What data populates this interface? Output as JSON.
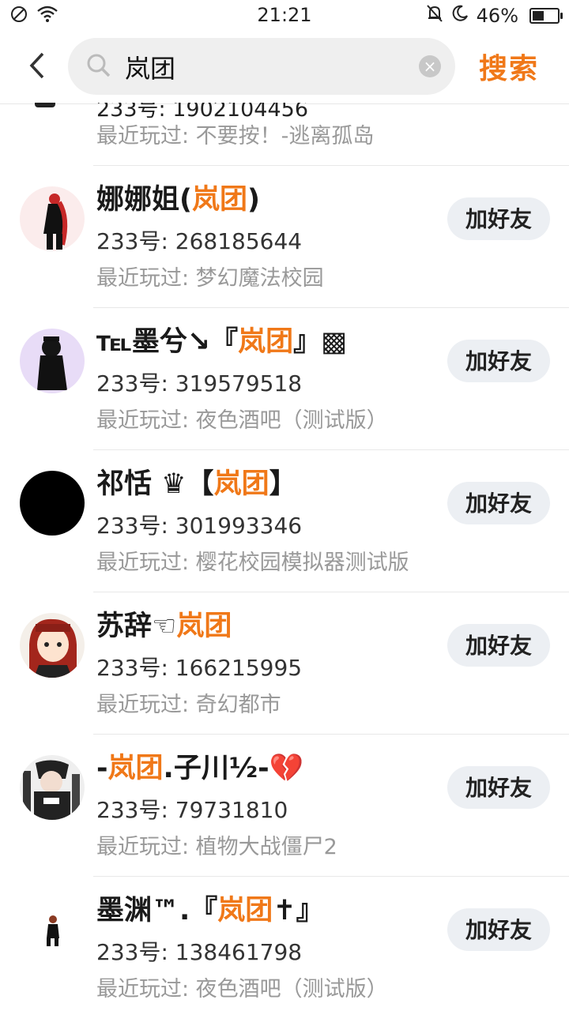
{
  "status_bar": {
    "time": "21:21",
    "battery": "46%",
    "battery_level": 0.46
  },
  "search": {
    "query": "岚团",
    "button_label": "搜索"
  },
  "highlight_color": "#f07818",
  "partial_row": {
    "id_text": "233号: 1902104456",
    "recent": "最近玩过: 不要按！-逃离孤岛"
  },
  "results": [
    {
      "name_pre": "娜娜姐(",
      "name_hl": "岚团",
      "name_post": ")",
      "id": "233号: 268185644",
      "recent": "最近玩过: 梦幻魔法校园",
      "button": "加好友"
    },
    {
      "name_pre": "℡墨兮↘『",
      "name_hl": "岚团",
      "name_post": "』▩",
      "id": "233号: 319579518",
      "recent": "最近玩过: 夜色酒吧（测试版）",
      "button": "加好友"
    },
    {
      "name_pre": "祁恬 ♛【",
      "name_hl": "岚团",
      "name_post": "】",
      "id": "233号: 301993346",
      "recent": "最近玩过: 樱花校园模拟器测试版",
      "button": "加好友"
    },
    {
      "name_pre": "苏辞☜",
      "name_hl": "岚团",
      "name_post": "",
      "id": "233号: 166215995",
      "recent": "最近玩过: 奇幻都市",
      "button": "加好友"
    },
    {
      "name_pre": "-",
      "name_hl": "岚团",
      "name_post": ".子川½-💔",
      "id": "233号: 79731810",
      "recent": "最近玩过: 植物大战僵尸2",
      "button": "加好友"
    },
    {
      "name_pre": "墨渊™.『",
      "name_hl": "岚团",
      "name_post": "✝』",
      "id": "233号: 138461798",
      "recent": "最近玩过: 夜色酒吧（测试版）",
      "button": "加好友"
    }
  ]
}
